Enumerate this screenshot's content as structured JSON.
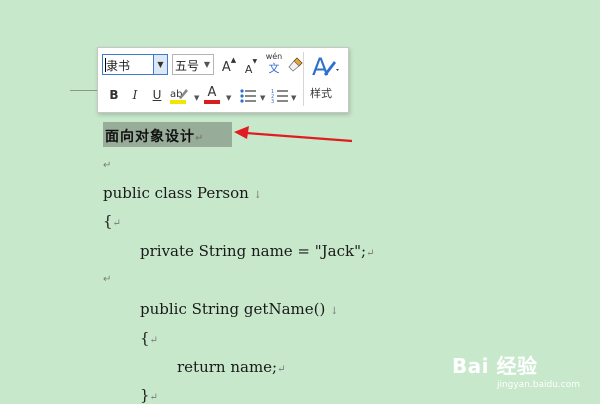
{
  "toolbar": {
    "font_name": "隶书",
    "font_size": "五号",
    "grow_font": "A",
    "shrink_font": "A",
    "pinyin_top": "wén",
    "pinyin_bottom": "文",
    "bold": "B",
    "italic": "I",
    "underline": "U",
    "highlight": "ab",
    "font_color": "A",
    "style_label": "样式",
    "colors": {
      "highlight": "#f2e600",
      "font_color": "#d81e1e",
      "style_icon": "#2f6fcf"
    }
  },
  "document": {
    "heading": "面向对象设计",
    "paragraph_mark": "↵",
    "line_break_mark": "↓",
    "code_lines": [
      "public class Person",
      "{",
      "private String name = \"Jack\";",
      "public String getName()",
      "{",
      "return name;",
      "}"
    ]
  },
  "annotation": {
    "color": "#e01b24"
  },
  "watermark": {
    "brand": "Bai 经验",
    "url": "jingyan.baidu.com"
  }
}
